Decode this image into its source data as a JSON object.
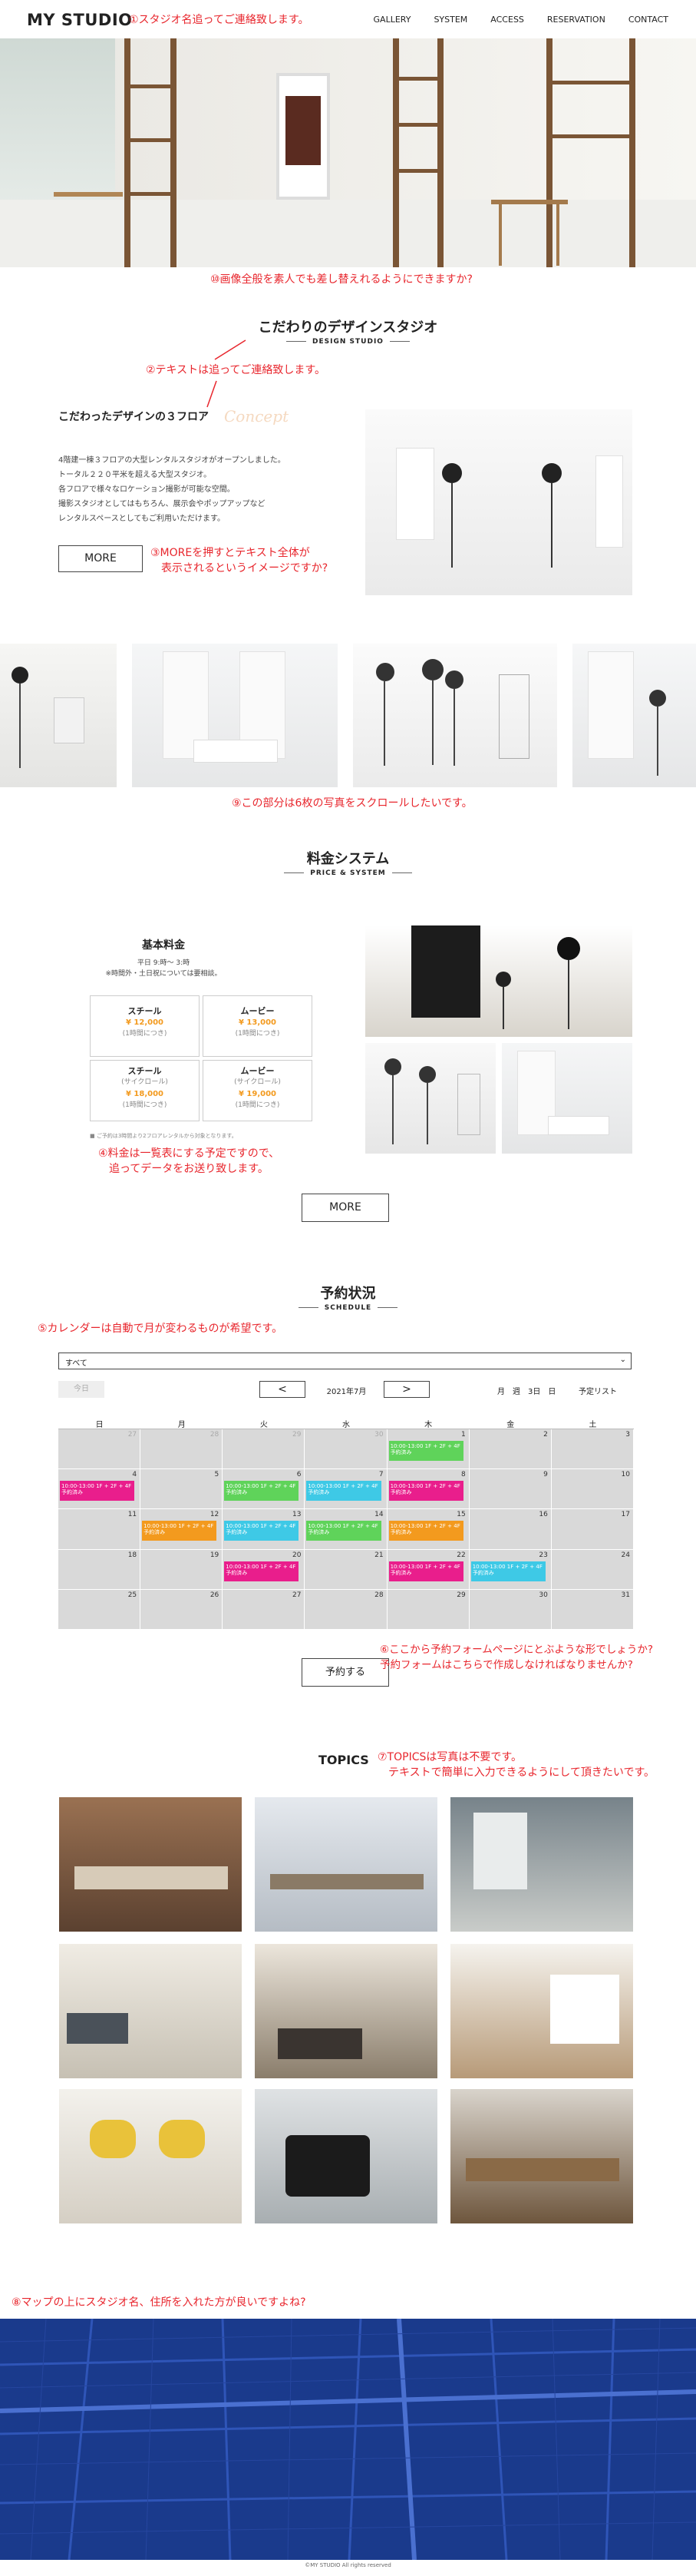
{
  "header": {
    "logo": "MY STUDIO",
    "note": "①スタジオ名追ってご連絡致します。",
    "nav": [
      "GALLERY",
      "SYSTEM",
      "ACCESS",
      "RESERVATION",
      "CONTACT"
    ]
  },
  "hero": {
    "note": "⑩画像全般を素人でも差し替えれるようにできますか?"
  },
  "design": {
    "title": "こだわりのデザインスタジオ",
    "subtitle": "DESIGN STUDIO",
    "note_text": "②テキストは追ってご連絡致します。",
    "heading": "こだわったデザインの３フロア",
    "script": "Concept",
    "body": [
      "4階建一棟３フロアの大型レンタルスタジオがオープンしました。",
      "トータル２２０平米を超える大型スタジオ。",
      "各フロアで様々なロケーション撮影が可能な空間。",
      "撮影スタジオとしてはもちろん、展示会やポップアップなど",
      "レンタルスペースとしてもご利用いただけます。"
    ],
    "more": "MORE",
    "note_more": "③MOREを押すとテキスト全体が\n　表示されるというイメージですか?"
  },
  "gallery": {
    "note": "⑨この部分は6枚の写真をスクロールしたいです。"
  },
  "price": {
    "title": "料金システム",
    "subtitle": "PRICE & SYSTEM",
    "basic": "基本料金",
    "hours": "平日 9:時〜 3:時",
    "hours_note": "※時間外・土日祝については要相談。",
    "cards": [
      {
        "name": "スチール",
        "tag": "",
        "price": "¥ 12,000",
        "per": "(1時間につき)"
      },
      {
        "name": "ムービー",
        "tag": "",
        "price": "¥ 13,000",
        "per": "(1時間につき)"
      },
      {
        "name": "スチール",
        "tag": "(サイクロール)",
        "price": "¥ 18,000",
        "per": "(1時間につき)"
      },
      {
        "name": "ムービー",
        "tag": "(サイクロール)",
        "price": "¥ 19,000",
        "per": "(1時間につき)"
      }
    ],
    "footnote": "■ ご予約は3時間より2フロアレンタルから対象となります。",
    "note": "④料金は一覧表にする予定ですので、\n　追ってデータをお送り致します。",
    "more": "MORE"
  },
  "reserve": {
    "title": "予約状況",
    "subtitle": "SCHEDULE",
    "note": "⑤カレンダーは自動で月が変わるものが希望です。",
    "select": "すべて",
    "today": "今日",
    "prev": "<",
    "month": "2021年7月",
    "next": ">",
    "views": [
      "月",
      "週",
      "3日",
      "日"
    ],
    "list": "予定リスト",
    "weekdays": [
      "日",
      "月",
      "火",
      "水",
      "木",
      "金",
      "土"
    ],
    "days": [
      [
        "27",
        "28",
        "29",
        "30",
        "1",
        "2",
        "3"
      ],
      [
        "4",
        "5",
        "6",
        "7",
        "8",
        "9",
        "10"
      ],
      [
        "11",
        "12",
        "13",
        "14",
        "15",
        "16",
        "17"
      ],
      [
        "18",
        "19",
        "20",
        "21",
        "22",
        "23",
        "24"
      ],
      [
        "25",
        "26",
        "27",
        "28",
        "29",
        "30",
        "31"
      ]
    ],
    "event_text": "10:00-13:00 1F + 2F + 4F 予約済み",
    "button": "予約する",
    "note_form": "⑥ここから予約フォームページにとぶような形でしょうか?\n予約フォームはこちらで作成しなければなりませんか?"
  },
  "topics": {
    "title": "TOPICS",
    "note": "⑦TOPICSは写真は不要です。\n　テキストで簡単に入力できるようにして頂きたいです。"
  },
  "map": {
    "note": "⑧マップの上にスタジオ名、住所を入れた方が良いですよね?"
  },
  "footer": {
    "copy": "©MY STUDIO All rights reserved"
  },
  "colors": {
    "accent_red": "#e8262d",
    "orange": "#f39a1e",
    "magenta": "#e91e8c",
    "green": "#5fd35a",
    "cyan": "#3ec9e6",
    "map": "#1a3a8c"
  }
}
